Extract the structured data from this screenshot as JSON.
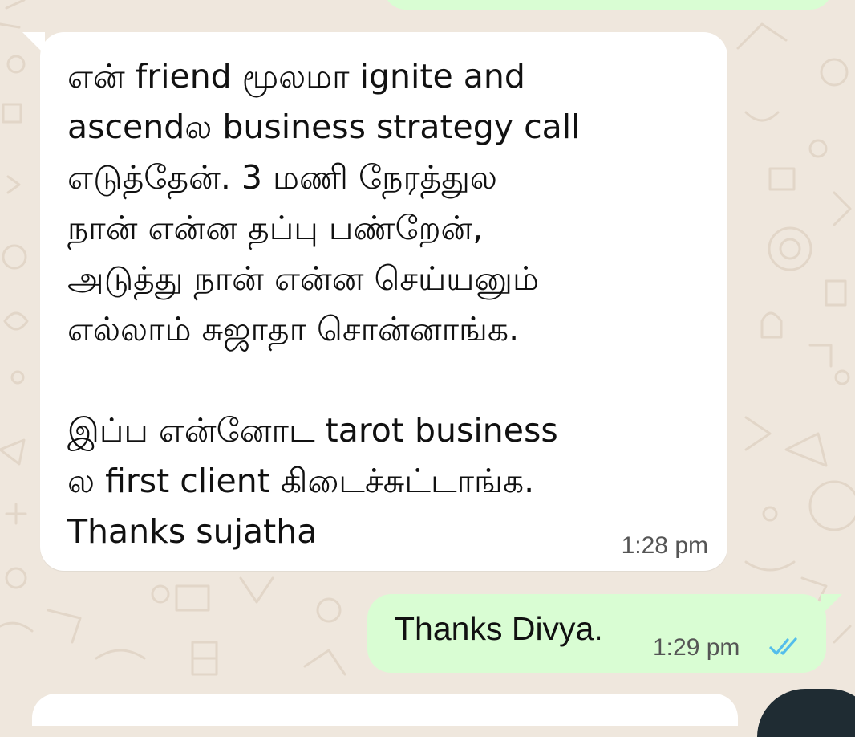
{
  "chat": {
    "messages": [
      {
        "direction": "incoming",
        "text": "என் friend மூலமா ignite and\nascendல business strategy call\nஎடுத்தேன். 3 மணி நேரத்துல\nநான் என்ன தப்பு பண்றேன்,\nஅடுத்து நான் என்ன செய்யனும்\nஎல்லாம் சுஜாதா சொன்னாங்க.\n\nஇப்ப என்னோட tarot business\nல first client கிடைச்சுட்டாங்க.\nThanks sujatha",
        "time": "1:28 pm"
      },
      {
        "direction": "outgoing",
        "text": "Thanks Divya.",
        "time": "1:29 pm",
        "status_icon": "double-check-read-icon"
      }
    ]
  },
  "colors": {
    "background": "#efe7dd",
    "incoming_bubble": "#ffffff",
    "outgoing_bubble": "#d9fdd3",
    "read_ticks": "#53bdeb",
    "time_text": "#555555"
  }
}
